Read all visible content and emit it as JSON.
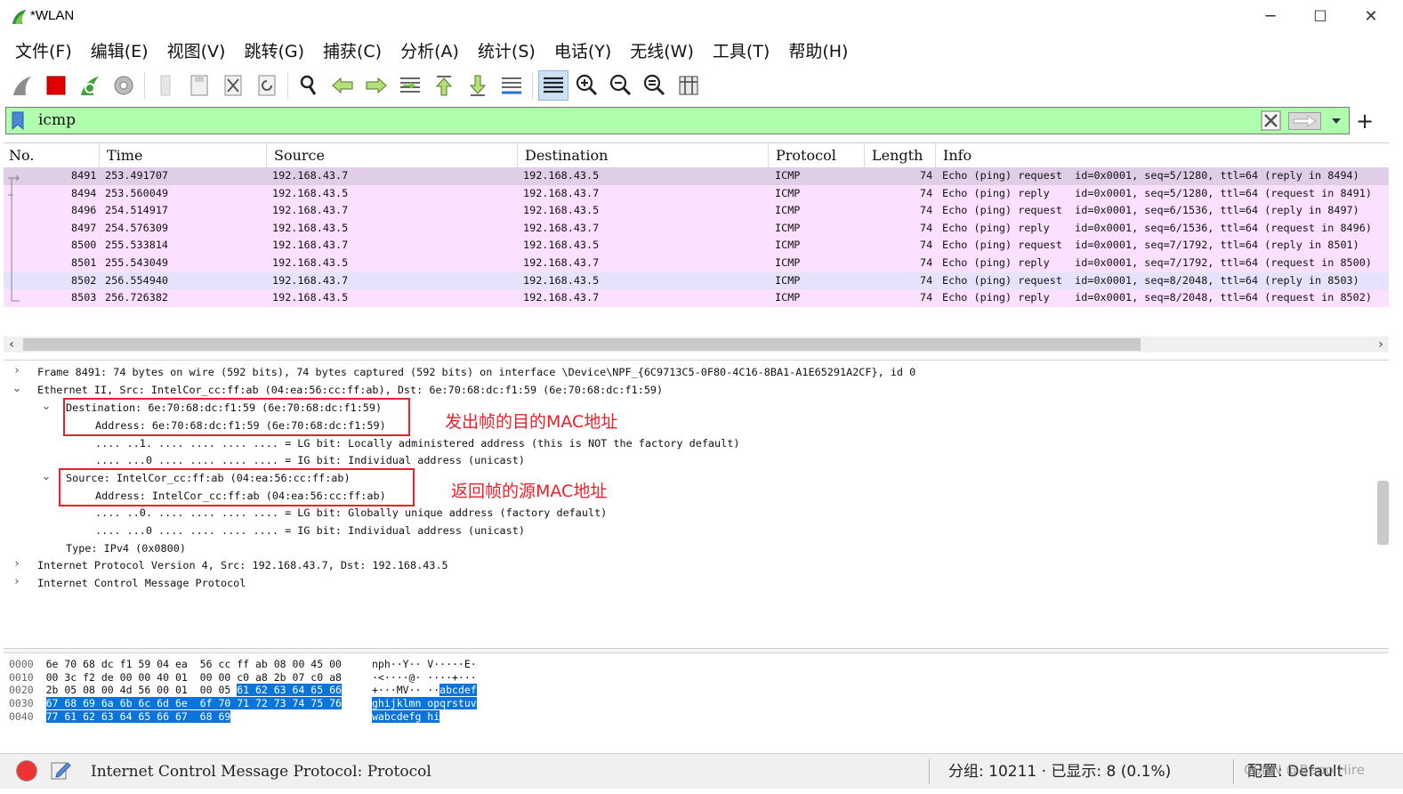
{
  "window": {
    "title": "*WLAN",
    "minimize": "─",
    "maximize": "☐",
    "close": "✕"
  },
  "menu": [
    "文件(F)",
    "编辑(E)",
    "视图(V)",
    "跳转(G)",
    "捕获(C)",
    "分析(A)",
    "统计(S)",
    "电话(Y)",
    "无线(W)",
    "工具(T)",
    "帮助(H)"
  ],
  "toolbar_icons": [
    "shark-fin-start-icon",
    "stop-capture-icon",
    "restart-capture-icon",
    "capture-options-icon",
    "open-file-icon",
    "save-file-icon",
    "close-file-icon",
    "reload-file-icon",
    "find-packet-icon",
    "go-back-icon",
    "go-forward-icon",
    "go-to-packet-icon",
    "go-first-icon",
    "go-last-icon",
    "auto-scroll-icon",
    "colorize-icon",
    "zoom-in-icon",
    "zoom-out-icon",
    "zoom-normal-icon",
    "resize-columns-icon"
  ],
  "filter": {
    "value": "icmp"
  },
  "columns": [
    "No.",
    "Time",
    "Source",
    "Destination",
    "Protocol",
    "Length",
    "Info"
  ],
  "packets": [
    {
      "no": "8491",
      "time": "253.491707",
      "src": "192.168.43.7",
      "dst": "192.168.43.5",
      "proto": "ICMP",
      "len": "74",
      "info": "Echo (ping) request  id=0x0001, seq=5/1280, ttl=64 (reply in 8494)"
    },
    {
      "no": "8494",
      "time": "253.560049",
      "src": "192.168.43.5",
      "dst": "192.168.43.7",
      "proto": "ICMP",
      "len": "74",
      "info": "Echo (ping) reply    id=0x0001, seq=5/1280, ttl=64 (request in 8491)"
    },
    {
      "no": "8496",
      "time": "254.514917",
      "src": "192.168.43.7",
      "dst": "192.168.43.5",
      "proto": "ICMP",
      "len": "74",
      "info": "Echo (ping) request  id=0x0001, seq=6/1536, ttl=64 (reply in 8497)"
    },
    {
      "no": "8497",
      "time": "254.576309",
      "src": "192.168.43.5",
      "dst": "192.168.43.7",
      "proto": "ICMP",
      "len": "74",
      "info": "Echo (ping) reply    id=0x0001, seq=6/1536, ttl=64 (request in 8496)"
    },
    {
      "no": "8500",
      "time": "255.533814",
      "src": "192.168.43.7",
      "dst": "192.168.43.5",
      "proto": "ICMP",
      "len": "74",
      "info": "Echo (ping) request  id=0x0001, seq=7/1792, ttl=64 (reply in 8501)"
    },
    {
      "no": "8501",
      "time": "255.543049",
      "src": "192.168.43.5",
      "dst": "192.168.43.7",
      "proto": "ICMP",
      "len": "74",
      "info": "Echo (ping) reply    id=0x0001, seq=7/1792, ttl=64 (request in 8500)"
    },
    {
      "no": "8502",
      "time": "256.554940",
      "src": "192.168.43.7",
      "dst": "192.168.43.5",
      "proto": "ICMP",
      "len": "74",
      "info": "Echo (ping) request  id=0x0001, seq=8/2048, ttl=64 (reply in 8503)"
    },
    {
      "no": "8503",
      "time": "256.726382",
      "src": "192.168.43.5",
      "dst": "192.168.43.7",
      "proto": "ICMP",
      "len": "74",
      "info": "Echo (ping) reply    id=0x0001, seq=8/2048, ttl=64 (request in 8502)"
    }
  ],
  "details": {
    "frame": "Frame 8491: 74 bytes on wire (592 bits), 74 bytes captured (592 bits) on interface \\Device\\NPF_{6C9713C5-0F80-4C16-8BA1-A1E65291A2CF}, id 0",
    "ethernet": "Ethernet II, Src: IntelCor_cc:ff:ab (04:ea:56:cc:ff:ab), Dst: 6e:70:68:dc:f1:59 (6e:70:68:dc:f1:59)",
    "dst": "Destination: 6e:70:68:dc:f1:59 (6e:70:68:dc:f1:59)",
    "dst_addr": "Address: 6e:70:68:dc:f1:59 (6e:70:68:dc:f1:59)",
    "dst_lg": ".... ..1. .... .... .... .... = LG bit: Locally administered address (this is NOT the factory default)",
    "dst_ig": ".... ...0 .... .... .... .... = IG bit: Individual address (unicast)",
    "src": "Source: IntelCor_cc:ff:ab (04:ea:56:cc:ff:ab)",
    "src_addr": "Address: IntelCor_cc:ff:ab (04:ea:56:cc:ff:ab)",
    "src_lg": ".... ..0. .... .... .... .... = LG bit: Globally unique address (factory default)",
    "src_ig": ".... ...0 .... .... .... .... = IG bit: Individual address (unicast)",
    "type": "Type: IPv4 (0x0800)",
    "ip": "Internet Protocol Version 4, Src: 192.168.43.7, Dst: 192.168.43.5",
    "icmp": "Internet Control Message Protocol"
  },
  "annotations": {
    "dst_note": "发出帧的目的MAC地址",
    "src_note": "返回帧的源MAC地址",
    "color": "#e8202a"
  },
  "hex": [
    {
      "off": "0000",
      "a": "6e 70 68 dc f1 59 04 ea",
      "b": "56 cc ff ab 08 00 45 00",
      "asc": "nph··Y·· V·····E·"
    },
    {
      "off": "0010",
      "a": "00 3c f2 de 00 00 40 01",
      "b": "00 00 c0 a8 2b 07 c0 a8",
      "asc": "·<····@· ····+···"
    },
    {
      "off": "0020",
      "a": "2b 05 08 00 4d 56 00 01",
      "b0": "00 05 ",
      "b1": "61 62 63 64 65 66",
      "asc0": "+···MV·· ··",
      "asc1": "abcdef"
    },
    {
      "off": "0030",
      "a": "67 68 69 6a 6b 6c 6d 6e",
      "b": "6f 70 71 72 73 74 75 76",
      "asc": "ghijklmn opqrstuv"
    },
    {
      "off": "0040",
      "a": "77 61 62 63 64 65 66 67",
      "b": "68 69",
      "asc": "wabcdefg hi"
    }
  ],
  "status": {
    "text": "Internet Control Message Protocol: Protocol",
    "packets": "分组: 10211 · 已显示: 8 (0.1%)",
    "profile": "配置: Default",
    "watermark": "CSDN @Bepo Hire"
  },
  "colors": {
    "filter_valid": "#afffaf",
    "row_icmp": "#fce0ff",
    "row_selected": "#e0cde6",
    "hex_highlight": "#0a74da"
  }
}
